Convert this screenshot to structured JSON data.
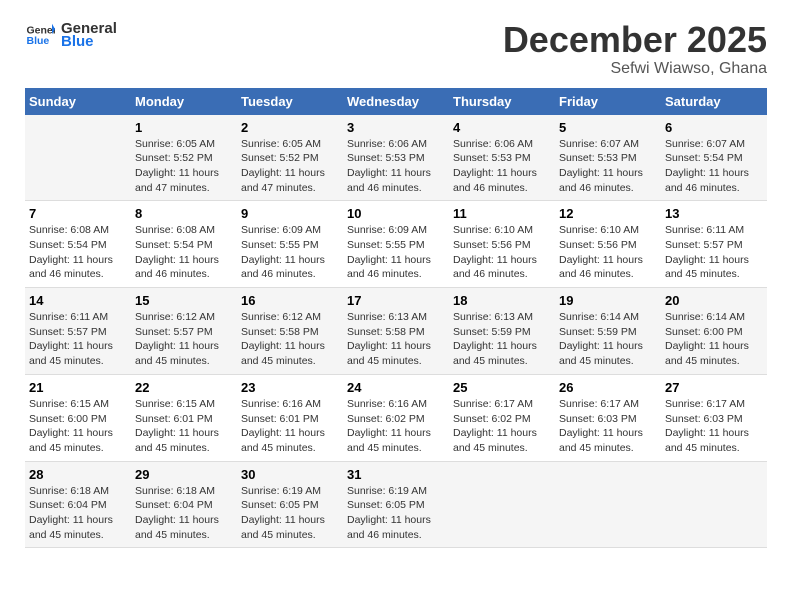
{
  "logo": {
    "line1": "General",
    "line2": "Blue"
  },
  "title": "December 2025",
  "location": "Sefwi Wiawso, Ghana",
  "days_of_week": [
    "Sunday",
    "Monday",
    "Tuesday",
    "Wednesday",
    "Thursday",
    "Friday",
    "Saturday"
  ],
  "weeks": [
    [
      {
        "day": "",
        "info": ""
      },
      {
        "day": "1",
        "info": "Sunrise: 6:05 AM\nSunset: 5:52 PM\nDaylight: 11 hours\nand 47 minutes."
      },
      {
        "day": "2",
        "info": "Sunrise: 6:05 AM\nSunset: 5:52 PM\nDaylight: 11 hours\nand 47 minutes."
      },
      {
        "day": "3",
        "info": "Sunrise: 6:06 AM\nSunset: 5:53 PM\nDaylight: 11 hours\nand 46 minutes."
      },
      {
        "day": "4",
        "info": "Sunrise: 6:06 AM\nSunset: 5:53 PM\nDaylight: 11 hours\nand 46 minutes."
      },
      {
        "day": "5",
        "info": "Sunrise: 6:07 AM\nSunset: 5:53 PM\nDaylight: 11 hours\nand 46 minutes."
      },
      {
        "day": "6",
        "info": "Sunrise: 6:07 AM\nSunset: 5:54 PM\nDaylight: 11 hours\nand 46 minutes."
      }
    ],
    [
      {
        "day": "7",
        "info": "Sunrise: 6:08 AM\nSunset: 5:54 PM\nDaylight: 11 hours\nand 46 minutes."
      },
      {
        "day": "8",
        "info": "Sunrise: 6:08 AM\nSunset: 5:54 PM\nDaylight: 11 hours\nand 46 minutes."
      },
      {
        "day": "9",
        "info": "Sunrise: 6:09 AM\nSunset: 5:55 PM\nDaylight: 11 hours\nand 46 minutes."
      },
      {
        "day": "10",
        "info": "Sunrise: 6:09 AM\nSunset: 5:55 PM\nDaylight: 11 hours\nand 46 minutes."
      },
      {
        "day": "11",
        "info": "Sunrise: 6:10 AM\nSunset: 5:56 PM\nDaylight: 11 hours\nand 46 minutes."
      },
      {
        "day": "12",
        "info": "Sunrise: 6:10 AM\nSunset: 5:56 PM\nDaylight: 11 hours\nand 46 minutes."
      },
      {
        "day": "13",
        "info": "Sunrise: 6:11 AM\nSunset: 5:57 PM\nDaylight: 11 hours\nand 45 minutes."
      }
    ],
    [
      {
        "day": "14",
        "info": "Sunrise: 6:11 AM\nSunset: 5:57 PM\nDaylight: 11 hours\nand 45 minutes."
      },
      {
        "day": "15",
        "info": "Sunrise: 6:12 AM\nSunset: 5:57 PM\nDaylight: 11 hours\nand 45 minutes."
      },
      {
        "day": "16",
        "info": "Sunrise: 6:12 AM\nSunset: 5:58 PM\nDaylight: 11 hours\nand 45 minutes."
      },
      {
        "day": "17",
        "info": "Sunrise: 6:13 AM\nSunset: 5:58 PM\nDaylight: 11 hours\nand 45 minutes."
      },
      {
        "day": "18",
        "info": "Sunrise: 6:13 AM\nSunset: 5:59 PM\nDaylight: 11 hours\nand 45 minutes."
      },
      {
        "day": "19",
        "info": "Sunrise: 6:14 AM\nSunset: 5:59 PM\nDaylight: 11 hours\nand 45 minutes."
      },
      {
        "day": "20",
        "info": "Sunrise: 6:14 AM\nSunset: 6:00 PM\nDaylight: 11 hours\nand 45 minutes."
      }
    ],
    [
      {
        "day": "21",
        "info": "Sunrise: 6:15 AM\nSunset: 6:00 PM\nDaylight: 11 hours\nand 45 minutes."
      },
      {
        "day": "22",
        "info": "Sunrise: 6:15 AM\nSunset: 6:01 PM\nDaylight: 11 hours\nand 45 minutes."
      },
      {
        "day": "23",
        "info": "Sunrise: 6:16 AM\nSunset: 6:01 PM\nDaylight: 11 hours\nand 45 minutes."
      },
      {
        "day": "24",
        "info": "Sunrise: 6:16 AM\nSunset: 6:02 PM\nDaylight: 11 hours\nand 45 minutes."
      },
      {
        "day": "25",
        "info": "Sunrise: 6:17 AM\nSunset: 6:02 PM\nDaylight: 11 hours\nand 45 minutes."
      },
      {
        "day": "26",
        "info": "Sunrise: 6:17 AM\nSunset: 6:03 PM\nDaylight: 11 hours\nand 45 minutes."
      },
      {
        "day": "27",
        "info": "Sunrise: 6:17 AM\nSunset: 6:03 PM\nDaylight: 11 hours\nand 45 minutes."
      }
    ],
    [
      {
        "day": "28",
        "info": "Sunrise: 6:18 AM\nSunset: 6:04 PM\nDaylight: 11 hours\nand 45 minutes."
      },
      {
        "day": "29",
        "info": "Sunrise: 6:18 AM\nSunset: 6:04 PM\nDaylight: 11 hours\nand 45 minutes."
      },
      {
        "day": "30",
        "info": "Sunrise: 6:19 AM\nSunset: 6:05 PM\nDaylight: 11 hours\nand 45 minutes."
      },
      {
        "day": "31",
        "info": "Sunrise: 6:19 AM\nSunset: 6:05 PM\nDaylight: 11 hours\nand 46 minutes."
      },
      {
        "day": "",
        "info": ""
      },
      {
        "day": "",
        "info": ""
      },
      {
        "day": "",
        "info": ""
      }
    ]
  ]
}
